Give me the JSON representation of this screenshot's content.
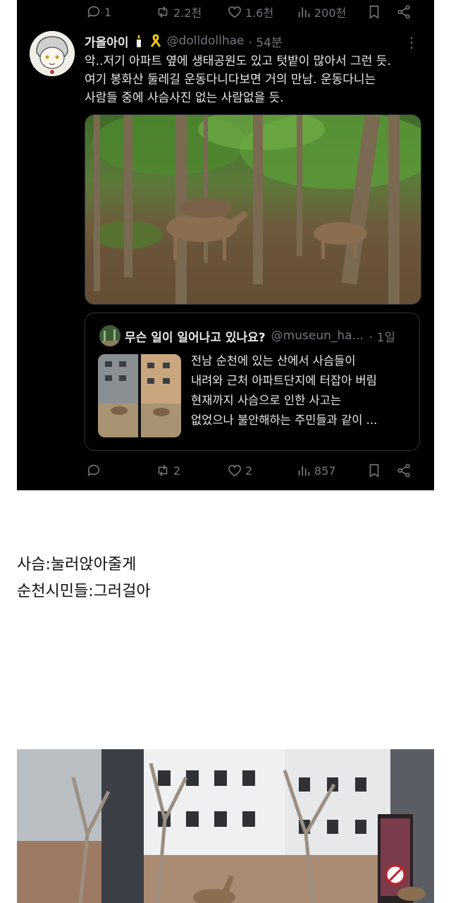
{
  "top_actions": {
    "replies": "1",
    "reposts": "2.2천",
    "likes": "1.6천",
    "views": "200천"
  },
  "tweet": {
    "name": "가을아이",
    "handle": "@dolldollhae",
    "time": "· 54분",
    "lines": [
      "악..저기 아파트 옆에 생태공원도 있고 텃밭이 많아서 그런 듯.",
      "여기 봉화산 둘레길 운동다니다보면 거의 만남. 운동다니는",
      "사람들 중에 사슴사진 없는 사람없을 듯."
    ],
    "quote": {
      "name": "무슨 일이 일어나고 있나요?",
      "handle": "@museun_ha...",
      "time": "· 1일",
      "lines": [
        "전남 순천에 있는 산에서 사슴들이",
        "내려와 근처 아파트단지에 터잡아 버림",
        "현재까지 사슴으로 인한 사고는",
        "없었으나 불안해하는 주민들과 같이 ..."
      ]
    },
    "actions": {
      "replies": "",
      "reposts": "2",
      "likes": "2",
      "views": "857"
    }
  },
  "captions": [
    "사슴:눌러앉아줄게",
    "순천시민들:그러걸아"
  ],
  "colors": {
    "card_bg": "#000000",
    "muted": "#71767b",
    "text": "#e7e9ea"
  }
}
